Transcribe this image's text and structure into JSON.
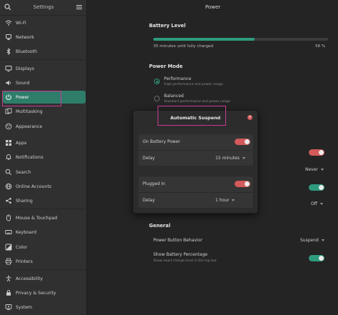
{
  "sidebar": {
    "title": "Settings",
    "items": [
      {
        "label": "Wi-Fi",
        "icon": "wifi-icon"
      },
      {
        "label": "Network",
        "icon": "network-icon"
      },
      {
        "label": "Bluetooth",
        "icon": "bluetooth-icon"
      },
      {
        "label": "Displays",
        "icon": "display-icon"
      },
      {
        "label": "Sound",
        "icon": "sound-icon"
      },
      {
        "label": "Power",
        "icon": "power-icon"
      },
      {
        "label": "Multitasking",
        "icon": "multitasking-icon"
      },
      {
        "label": "Appearance",
        "icon": "appearance-icon"
      },
      {
        "label": "Apps",
        "icon": "apps-icon"
      },
      {
        "label": "Notifications",
        "icon": "notifications-icon"
      },
      {
        "label": "Search",
        "icon": "search-icon"
      },
      {
        "label": "Online Accounts",
        "icon": "online-accounts-icon"
      },
      {
        "label": "Sharing",
        "icon": "sharing-icon"
      },
      {
        "label": "Mouse & Touchpad",
        "icon": "mouse-icon"
      },
      {
        "label": "Keyboard",
        "icon": "keyboard-icon"
      },
      {
        "label": "Color",
        "icon": "color-icon"
      },
      {
        "label": "Printers",
        "icon": "printer-icon"
      },
      {
        "label": "Accessibility",
        "icon": "accessibility-icon"
      },
      {
        "label": "Privacy & Security",
        "icon": "privacy-icon"
      },
      {
        "label": "System",
        "icon": "system-icon"
      }
    ],
    "active": "Power"
  },
  "main": {
    "title": "Power",
    "battery": {
      "section_title": "Battery Level",
      "status": "35 minutes until fully charged",
      "percent_text": "58 %",
      "level_fraction": 0.58
    },
    "power_mode": {
      "section_title": "Power Mode",
      "options": [
        {
          "label": "Performance",
          "subtitle": "High performance and power usage",
          "selected": true
        },
        {
          "label": "Balanced",
          "subtitle": "Standard performance and power usage",
          "selected": false
        }
      ]
    },
    "partial": {
      "never_value": "Never",
      "off_value": "Off"
    },
    "general": {
      "section_title": "General",
      "power_button_label": "Power Button Behavior",
      "power_button_value": "Suspend",
      "show_percent_label": "Show Battery Percentage",
      "show_percent_subtitle": "Show exact charge level in the top bar"
    }
  },
  "dialog": {
    "title": "Automatic Suspend",
    "battery_card": {
      "toggle_label": "On Battery Power",
      "delay_label": "Delay",
      "delay_value": "15 minutes"
    },
    "plugged_card": {
      "toggle_label": "Plugged In",
      "delay_label": "Delay",
      "delay_value": "1 hour"
    }
  },
  "colors": {
    "accent": "#2e9b7e",
    "active_item": "#2e7d6a",
    "toggle_red": "#d25a5a",
    "highlight": "#c83b93"
  }
}
